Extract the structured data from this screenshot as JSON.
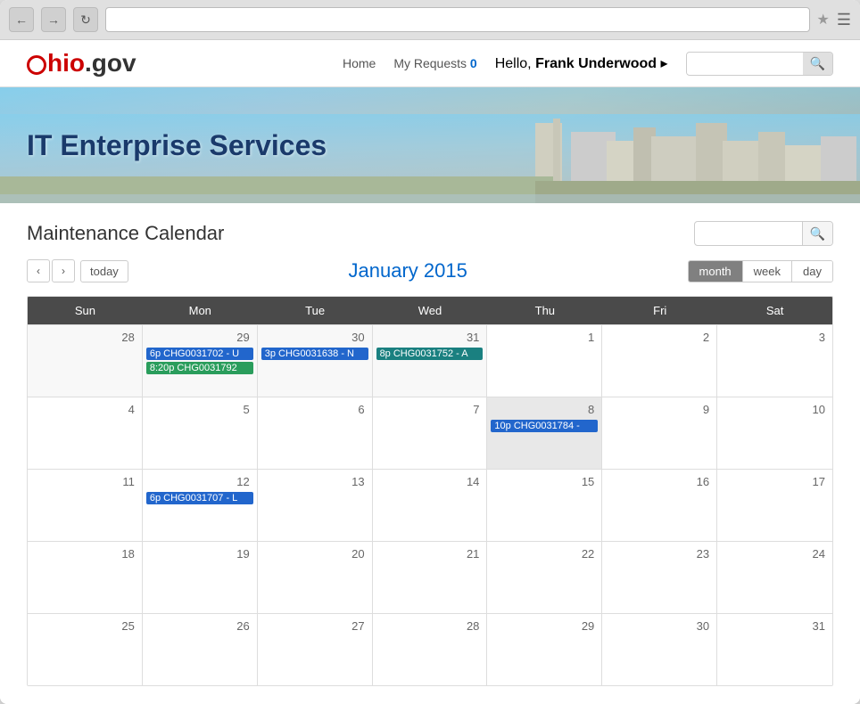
{
  "browser": {
    "address": ""
  },
  "header": {
    "logo_o": "O",
    "logo_ohio": "hio",
    "logo_gov": ".gov",
    "nav": {
      "home": "Home",
      "my_requests": "My Requests",
      "requests_count": "0",
      "hello": "Hello,",
      "user_name": "Frank Underwood",
      "user_arrow": "▸"
    },
    "search_placeholder": ""
  },
  "hero": {
    "title": "IT Enterprise Services"
  },
  "calendar": {
    "title": "Maintenance Calendar",
    "search_placeholder": "",
    "month_label": "January 2015",
    "today_btn": "today",
    "views": [
      "month",
      "week",
      "day"
    ],
    "active_view": "month",
    "day_headers": [
      "Sun",
      "Mon",
      "Tue",
      "Wed",
      "Thu",
      "Fri",
      "Sat"
    ],
    "weeks": [
      {
        "days": [
          {
            "date": "28",
            "other": true,
            "events": []
          },
          {
            "date": "29",
            "other": true,
            "events": [
              {
                "label": "6p CHG0031702 - U",
                "color": "blue"
              },
              {
                "label": "8:20p CHG0031792",
                "color": "green"
              }
            ]
          },
          {
            "date": "30",
            "other": true,
            "events": [
              {
                "label": "3p CHG0031638 - N",
                "color": "blue"
              }
            ]
          },
          {
            "date": "31",
            "other": true,
            "events": [
              {
                "label": "8p CHG0031752 - A",
                "color": "teal"
              }
            ]
          },
          {
            "date": "1",
            "events": []
          },
          {
            "date": "2",
            "events": []
          },
          {
            "date": "3",
            "events": []
          }
        ]
      },
      {
        "days": [
          {
            "date": "4",
            "events": []
          },
          {
            "date": "5",
            "events": []
          },
          {
            "date": "6",
            "events": []
          },
          {
            "date": "7",
            "events": []
          },
          {
            "date": "8",
            "today": true,
            "events": [
              {
                "label": "10p CHG0031784 -",
                "color": "blue"
              }
            ]
          },
          {
            "date": "9",
            "events": []
          },
          {
            "date": "10",
            "events": []
          }
        ]
      },
      {
        "days": [
          {
            "date": "11",
            "events": []
          },
          {
            "date": "12",
            "events": [
              {
                "label": "6p CHG0031707 - L",
                "color": "blue"
              }
            ]
          },
          {
            "date": "13",
            "events": []
          },
          {
            "date": "14",
            "events": []
          },
          {
            "date": "15",
            "events": []
          },
          {
            "date": "16",
            "events": []
          },
          {
            "date": "17",
            "events": []
          }
        ]
      },
      {
        "days": [
          {
            "date": "18",
            "events": []
          },
          {
            "date": "19",
            "events": []
          },
          {
            "date": "20",
            "events": []
          },
          {
            "date": "21",
            "events": []
          },
          {
            "date": "22",
            "events": []
          },
          {
            "date": "23",
            "events": []
          },
          {
            "date": "24",
            "events": []
          }
        ]
      },
      {
        "days": [
          {
            "date": "25",
            "events": []
          },
          {
            "date": "26",
            "events": []
          },
          {
            "date": "27",
            "events": []
          },
          {
            "date": "28",
            "events": []
          },
          {
            "date": "29",
            "events": []
          },
          {
            "date": "30",
            "events": []
          },
          {
            "date": "31",
            "events": []
          }
        ]
      }
    ]
  }
}
